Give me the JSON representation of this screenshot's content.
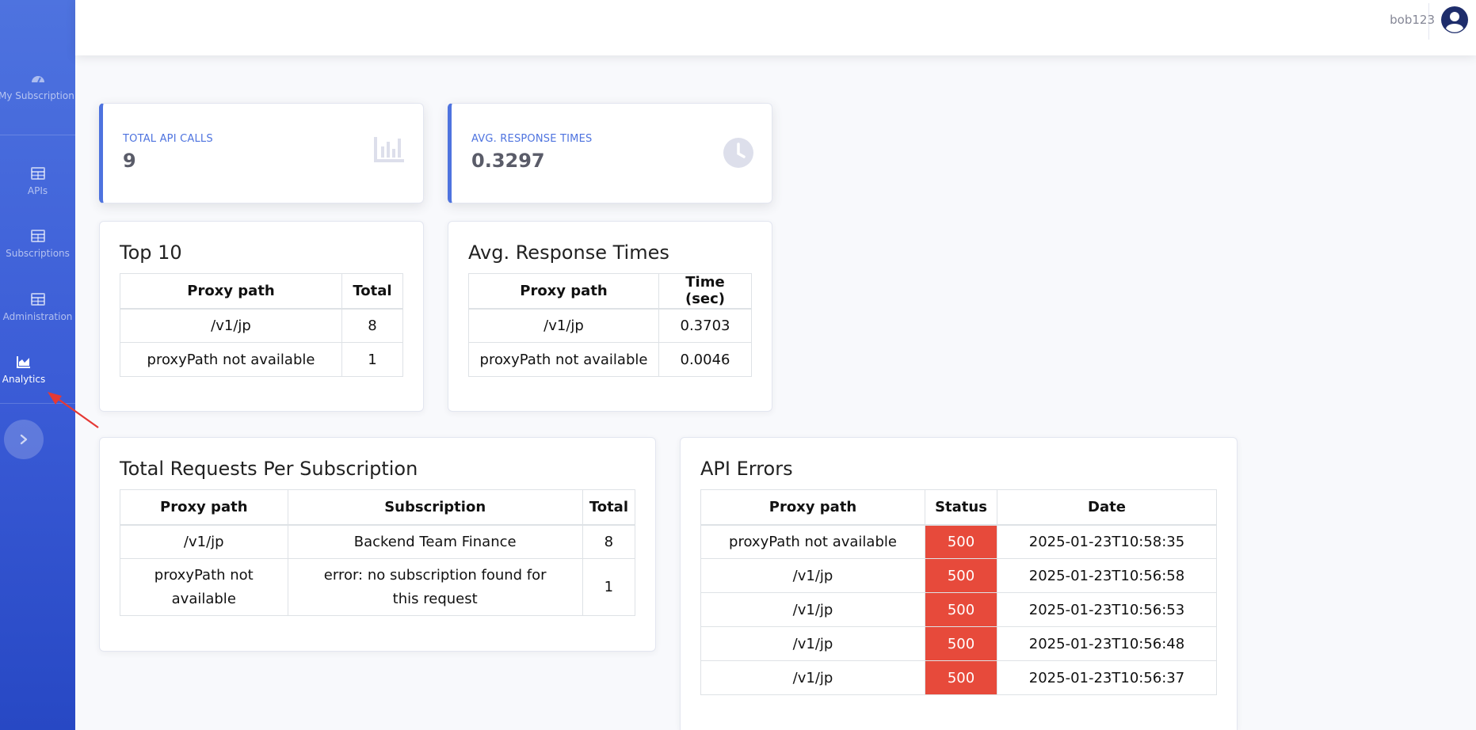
{
  "sidebar": {
    "items": [
      {
        "label": "My Subscription",
        "icon": "dashboard-icon",
        "active": false
      },
      {
        "label": "APIs",
        "icon": "table-icon",
        "active": false
      },
      {
        "label": "Subscriptions",
        "icon": "table-icon",
        "active": false
      },
      {
        "label": "Administration",
        "icon": "table-icon",
        "active": false
      },
      {
        "label": "Analytics",
        "icon": "area-chart-icon",
        "active": true
      }
    ],
    "toggle_icon": "chevron-right-icon"
  },
  "topbar": {
    "username": "bob123",
    "avatar_icon": "user-circle-icon"
  },
  "stats": {
    "total_calls": {
      "label": "TOTAL API CALLS",
      "value": "9",
      "icon": "bar-chart-icon"
    },
    "avg_response": {
      "label": "AVG. RESPONSE TIMES",
      "value": "0.3297",
      "icon": "clock-icon"
    }
  },
  "top10": {
    "title": "Top 10",
    "headers": [
      "Proxy path",
      "Total"
    ],
    "rows": [
      [
        "/v1/jp",
        "8"
      ],
      [
        "proxyPath not available",
        "1"
      ]
    ]
  },
  "avg_times": {
    "title": "Avg. Response Times",
    "headers": [
      "Proxy path",
      "Time (sec)"
    ],
    "rows": [
      [
        "/v1/jp",
        "0.3703"
      ],
      [
        "proxyPath not available",
        "0.0046"
      ]
    ]
  },
  "per_subscription": {
    "title": "Total Requests Per Subscription",
    "headers": [
      "Proxy path",
      "Subscription",
      "Total"
    ],
    "rows": [
      [
        "/v1/jp",
        "Backend Team Finance",
        "8"
      ],
      [
        "proxyPath not available",
        "error: no subscription found for this request",
        "1"
      ]
    ]
  },
  "api_errors": {
    "title": "API Errors",
    "headers": [
      "Proxy path",
      "Status",
      "Date"
    ],
    "rows": [
      [
        "proxyPath not available",
        "500",
        "2025-01-23T10:58:35"
      ],
      [
        "/v1/jp",
        "500",
        "2025-01-23T10:56:58"
      ],
      [
        "/v1/jp",
        "500",
        "2025-01-23T10:56:53"
      ],
      [
        "/v1/jp",
        "500",
        "2025-01-23T10:56:48"
      ],
      [
        "/v1/jp",
        "500",
        "2025-01-23T10:56:37"
      ]
    ]
  },
  "colors": {
    "primary": "#4e73df",
    "error": "#e74a3b",
    "annotation_arrow": "#e53935"
  }
}
